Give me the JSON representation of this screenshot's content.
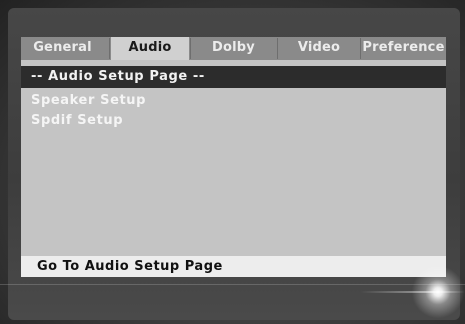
{
  "tabs": [
    {
      "label": "General",
      "active": false
    },
    {
      "label": "Audio",
      "active": true
    },
    {
      "label": "Dolby",
      "active": false
    },
    {
      "label": "Video",
      "active": false
    },
    {
      "label": "Preference",
      "active": false
    }
  ],
  "page": {
    "header": "-- Audio Setup Page --",
    "items": [
      {
        "label": "Speaker Setup"
      },
      {
        "label": "Spdif Setup"
      }
    ]
  },
  "status": {
    "text": "Go To Audio Setup Page"
  }
}
